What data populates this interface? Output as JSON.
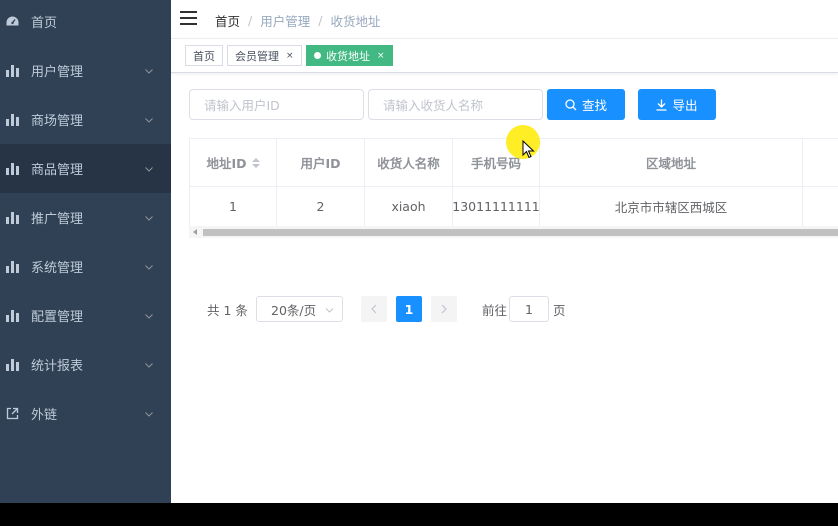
{
  "sidebar": {
    "items": [
      {
        "label": "首页",
        "icon": "dashboard-icon",
        "has_arrow": false
      },
      {
        "label": "用户管理",
        "icon": "bar-chart-icon",
        "has_arrow": true
      },
      {
        "label": "商场管理",
        "icon": "bar-chart-icon",
        "has_arrow": true
      },
      {
        "label": "商品管理",
        "icon": "bar-chart-icon",
        "has_arrow": true
      },
      {
        "label": "推广管理",
        "icon": "bar-chart-icon",
        "has_arrow": true
      },
      {
        "label": "系统管理",
        "icon": "bar-chart-icon",
        "has_arrow": true
      },
      {
        "label": "配置管理",
        "icon": "bar-chart-icon",
        "has_arrow": true
      },
      {
        "label": "统计报表",
        "icon": "bar-chart-icon",
        "has_arrow": true
      },
      {
        "label": "外链",
        "icon": "external-link-icon",
        "has_arrow": true
      }
    ]
  },
  "navbar": {
    "breadcrumb": [
      "首页",
      "用户管理",
      "收货地址"
    ],
    "separator": "/"
  },
  "tags": [
    {
      "label": "首页",
      "active": false,
      "closable": false
    },
    {
      "label": "会员管理",
      "active": false,
      "closable": true
    },
    {
      "label": "收货地址",
      "active": true,
      "closable": true
    }
  ],
  "tag_close_glyph": "×",
  "filters": {
    "user_id_placeholder": "请输入用户ID",
    "receiver_placeholder": "请输入收货人名称",
    "search_label": "查找",
    "export_label": "导出"
  },
  "table": {
    "columns": [
      "地址ID",
      "用户ID",
      "收货人名称",
      "手机号码",
      "区域地址"
    ],
    "rows": [
      [
        "1",
        "2",
        "xiaoh",
        "13011111111",
        "北京市市辖区西城区"
      ]
    ]
  },
  "pagination": {
    "total_text": "共 1 条",
    "page_size": "20条/页",
    "current_page": "1",
    "goto_prefix": "前往",
    "goto_value": "1",
    "goto_suffix": "页"
  },
  "colors": {
    "sidebar_bg": "#304156",
    "primary": "#1890ff",
    "active_tag": "#42b983"
  }
}
